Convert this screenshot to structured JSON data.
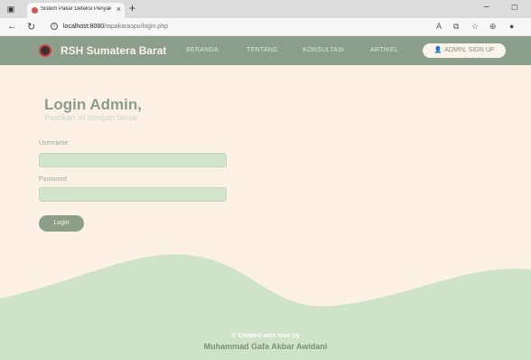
{
  "browser": {
    "tab_title": "Sistem Pakar Deteksi Penyakit S...",
    "url_host": "localhost:8080",
    "url_path": "/tapakaraspo/login.php"
  },
  "navbar": {
    "brand": "RSH Sumatera Barat",
    "menu": [
      "BERANDA",
      "TENTANG",
      "KONSULTASI",
      "ARTIKEL"
    ],
    "admin_button": "ADMIN, SIGN UP"
  },
  "login": {
    "title": "Login Admin,",
    "subtitle": "Pastikan isi dengan benar",
    "username_label": "Username",
    "username_value": "",
    "password_label": "Password",
    "password_value": "",
    "button": "Login"
  },
  "footer": {
    "line1": "© Created with love by",
    "line2": "Muhammad Gafa Akbar Awidani"
  },
  "colors": {
    "page_bg": "#fdf1e6",
    "navbar_bg": "#8a9e89",
    "input_bg": "#d3e4cd",
    "wave": "#cfe3c9"
  }
}
